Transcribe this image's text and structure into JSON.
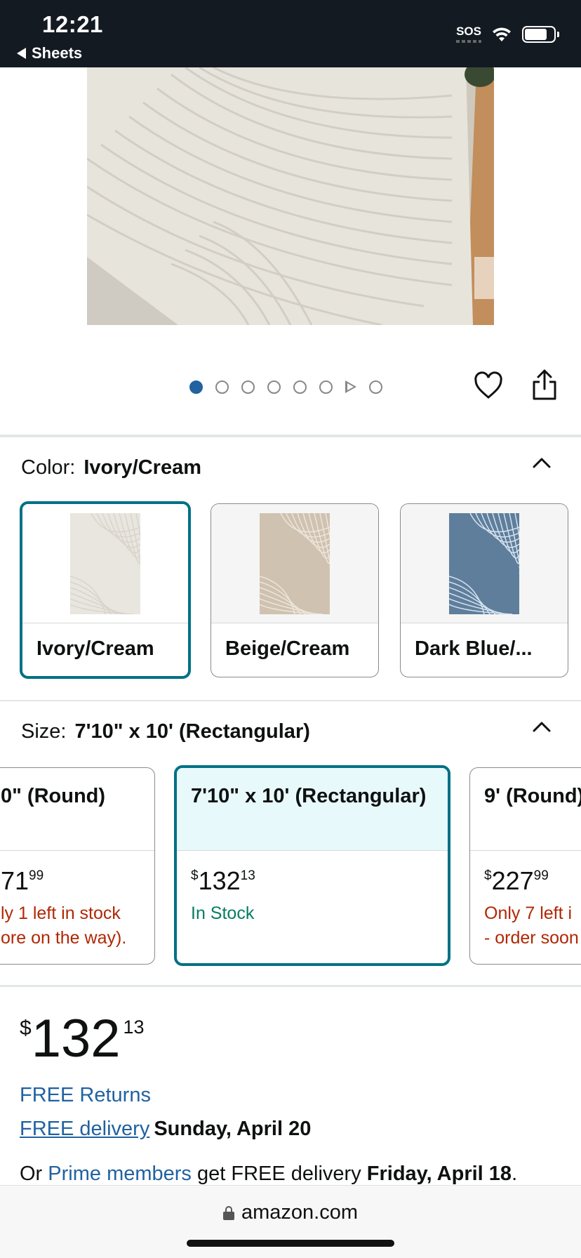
{
  "status_bar": {
    "time": "12:21",
    "back_app": "Sheets",
    "sos": "SOS",
    "battery_level": 0.78
  },
  "carousel": {
    "image_count": 8,
    "active_index": 0,
    "video_index": 6
  },
  "color": {
    "label": "Color:",
    "selected": "Ivory/Cream",
    "options": [
      {
        "name": "Ivory/Cream",
        "rug_color": "#e9e6df",
        "pattern_color": "#d8d4cc"
      },
      {
        "name": "Beige/Cream",
        "rug_color": "#cfc2b0",
        "pattern_color": "#ede5da"
      },
      {
        "name": "Dark Blue/...",
        "rug_color": "#5e7e9c",
        "pattern_color": "#d6e2ee"
      }
    ]
  },
  "size": {
    "label": "Size:",
    "selected": "7'10\" x 10' (Rectangular)",
    "options": [
      {
        "name": "0\" (Round)",
        "price_whole": "71",
        "price_frac": "99",
        "stock_line1": "ly 1 left in stock",
        "stock_line2": "ore on the way).",
        "stock_status": "low"
      },
      {
        "name": "7'10\" x 10' (Rectangular)",
        "currency": "$",
        "price_whole": "132",
        "price_frac": "13",
        "stock_line1": "In Stock",
        "stock_line2": "",
        "stock_status": "in"
      },
      {
        "name": "9' (Round)",
        "currency": "$",
        "price_whole": "227",
        "price_frac": "99",
        "stock_line1": "Only 7 left i",
        "stock_line2": "- order soon",
        "stock_status": "low"
      }
    ]
  },
  "price": {
    "currency": "$",
    "whole": "132",
    "fraction": "13"
  },
  "shipping": {
    "free_returns": "FREE Returns",
    "free_delivery_link": "FREE delivery",
    "delivery_date": "Sunday, April 20",
    "prime_prefix": "Or",
    "prime_link": "Prime members",
    "prime_middle": "get FREE delivery",
    "prime_date": "Friday, April 18",
    "prime_suffix": "."
  },
  "browser": {
    "url": "amazon.com"
  },
  "colors": {
    "accent_teal": "#007185",
    "link_blue": "#2162a1",
    "in_stock_green": "#067d62",
    "low_stock_red": "#b12704",
    "status_bar_bg": "#131a22"
  }
}
